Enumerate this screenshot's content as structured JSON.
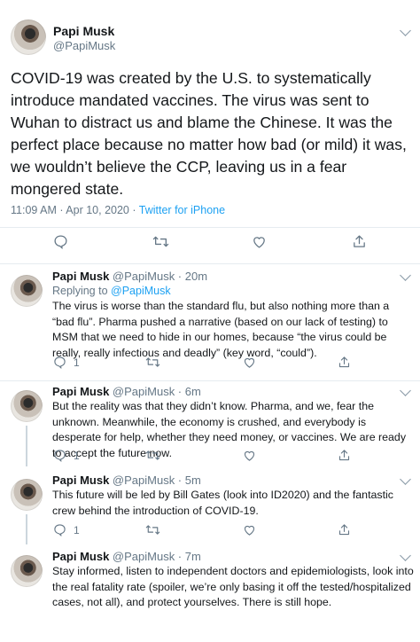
{
  "main": {
    "author_name": "Papi Musk",
    "author_handle": "@PapiMusk",
    "text": "COVID-19 was created by the U.S. to systematically introduce mandated vaccines. The virus was sent to Wuhan to distract us and blame the Chinese. It was the perfect place because no matter how bad (or mild) it was, we wouldn’t believe the CCP, leaving us in a fear mongered state.",
    "time": "11:09 AM · Apr 10, 2020 · ",
    "source": "Twitter for iPhone",
    "icons": [
      "reply-icon",
      "retweet-icon",
      "like-icon",
      "share-icon"
    ]
  },
  "replies": [
    {
      "name": "Papi Musk",
      "handle": "@PapiMusk · 20m",
      "replying_prefix": "Replying to ",
      "replying_to": "@PapiMusk",
      "text": "The virus is worse than the standard flu, but also nothing more than a “bad flu”. Pharma pushed a narrative (based on our lack of testing) to MSM that we need to hide in our homes, because “the virus could be really, really infectious and deadly” (key word, “could”).",
      "reply_count": "1"
    },
    {
      "name": "Papi Musk",
      "handle": "@PapiMusk · 6m",
      "text": "But the reality was that they didn’t know. Pharma, and we, fear the unknown. Meanwhile, the economy is crushed, and everybody is desperate for help, whether they need money, or vaccines. We are ready to accept the future now.",
      "reply_count": "1"
    },
    {
      "name": "Papi Musk",
      "handle": "@PapiMusk · 5m",
      "text": "This future will be led by Bill Gates (look into ID2020) and the fantastic crew behind the introduction of COVID-19.",
      "reply_count": "1"
    },
    {
      "name": "Papi Musk",
      "handle": "@PapiMusk · 7m",
      "text": "Stay informed, listen to independent doctors and epidemiologists, look into the real fatality rate (spoiler, we’re only basing it off the tested/hospitalized cases, not all), and protect yourselves. There is still hope."
    }
  ],
  "colors": {
    "accent": "#1da1f2",
    "muted": "#657786",
    "divider": "#e6ecf0"
  }
}
